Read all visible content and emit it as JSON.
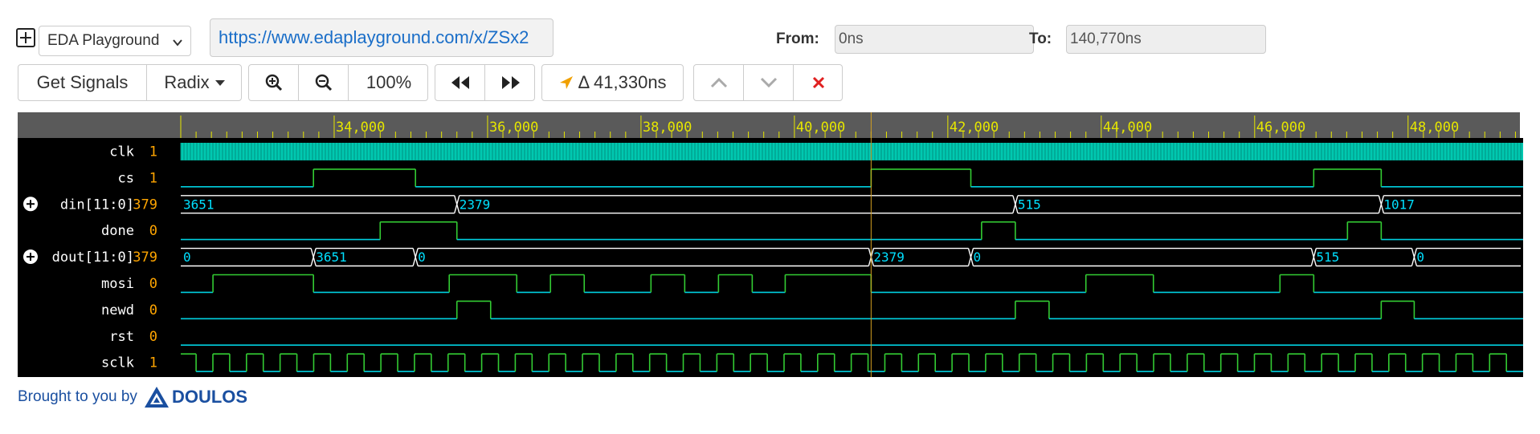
{
  "toolbar": {
    "expand_icon": "plus-square-icon",
    "site_select": "EDA Playground",
    "url": "https://www.edaplayground.com/x/ZSx2",
    "from_label": "From:",
    "from_value": "0ns",
    "to_label": "To:",
    "to_value": "140,770ns",
    "get_signals": "Get Signals",
    "radix": "Radix",
    "zoom_level": "100%",
    "delta": "Δ 41,330ns"
  },
  "colors": {
    "waveform_bg": "#000000",
    "ruler_bg": "#5a5a5a",
    "tick_color": "#e6e600",
    "signal_high": "#33cc33",
    "signal_low": "#00d0e0",
    "value_text": "#ffa500",
    "cursor": "#d4a020",
    "brand": "#1a4fa0",
    "close_red": "#e02020",
    "accent_arrow": "#f0a000"
  },
  "waveform": {
    "time_start": 32000,
    "time_end": 49500,
    "cursor_time": 41000,
    "ruler_labels": [
      "34,000",
      "36,000",
      "38,000",
      "40,000",
      "42,000",
      "44,000",
      "46,000",
      "48,000"
    ],
    "ruler_label_times": [
      34000,
      36000,
      38000,
      40000,
      42000,
      44000,
      46000,
      48000
    ],
    "signals": [
      {
        "name": "clk",
        "value": "1",
        "type": "clock"
      },
      {
        "name": "cs",
        "value": "1",
        "type": "bit",
        "init": 0,
        "edges": [
          33730,
          35060,
          41000,
          42300,
          46770,
          47650
        ]
      },
      {
        "name": "din[11:0]",
        "value": "379",
        "type": "bus",
        "expandable": true,
        "segments": [
          {
            "t": 32000,
            "v": "3651"
          },
          {
            "t": 35600,
            "v": "2379"
          },
          {
            "t": 42880,
            "v": "515"
          },
          {
            "t": 47650,
            "v": "1017"
          }
        ]
      },
      {
        "name": "done",
        "value": "0",
        "type": "bit",
        "init": 0,
        "edges": [
          34600,
          35600,
          42440,
          42880,
          47210,
          47650
        ]
      },
      {
        "name": "dout[11:0]",
        "value": "379",
        "type": "bus",
        "expandable": true,
        "segments": [
          {
            "t": 32000,
            "v": "0"
          },
          {
            "t": 33730,
            "v": "3651"
          },
          {
            "t": 35060,
            "v": "0"
          },
          {
            "t": 41000,
            "v": "2379"
          },
          {
            "t": 42300,
            "v": "0"
          },
          {
            "t": 46770,
            "v": "515"
          },
          {
            "t": 48080,
            "v": "0"
          }
        ]
      },
      {
        "name": "mosi",
        "value": "0",
        "type": "bit",
        "init": 0,
        "edges": [
          32420,
          33730,
          35500,
          36380,
          36820,
          37260,
          38130,
          38570,
          39010,
          39450,
          39880,
          41000,
          43800,
          44680,
          46330,
          46770
        ]
      },
      {
        "name": "newd",
        "value": "0",
        "type": "bit",
        "init": 0,
        "edges": [
          35600,
          36040,
          42880,
          43320,
          47650,
          48080
        ]
      },
      {
        "name": "rst",
        "value": "0",
        "type": "bit",
        "init": 0,
        "edges": []
      },
      {
        "name": "sclk",
        "value": "1",
        "type": "sclk",
        "period": 438,
        "first_edge": 32200
      }
    ]
  },
  "footer": {
    "brought_by": "Brought to you by",
    "brand_name": "DOULOS"
  }
}
